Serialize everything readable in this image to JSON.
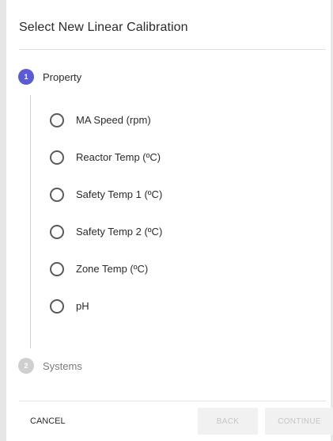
{
  "dialog": {
    "title": "Select New Linear Calibration"
  },
  "steps": [
    {
      "number": "1",
      "label": "Property",
      "state": "active"
    },
    {
      "number": "2",
      "label": "Systems",
      "state": "inactive"
    }
  ],
  "options": [
    {
      "label": "MA Speed (rpm)",
      "selected": false
    },
    {
      "label": "Reactor Temp (ºC)",
      "selected": false
    },
    {
      "label": "Safety Temp 1 (ºC)",
      "selected": false
    },
    {
      "label": "Safety Temp 2 (ºC)",
      "selected": false
    },
    {
      "label": "Zone Temp (ºC)",
      "selected": false
    },
    {
      "label": "pH",
      "selected": false
    }
  ],
  "footer": {
    "cancel_label": "CANCEL",
    "back_label": "BACK",
    "continue_label": "CONTINUE"
  },
  "colors": {
    "accent": "#5b5bd6",
    "inactive_step": "#cfcfcf",
    "disabled_button_bg": "#f1f1f1",
    "disabled_button_text": "#c6c6c6"
  }
}
